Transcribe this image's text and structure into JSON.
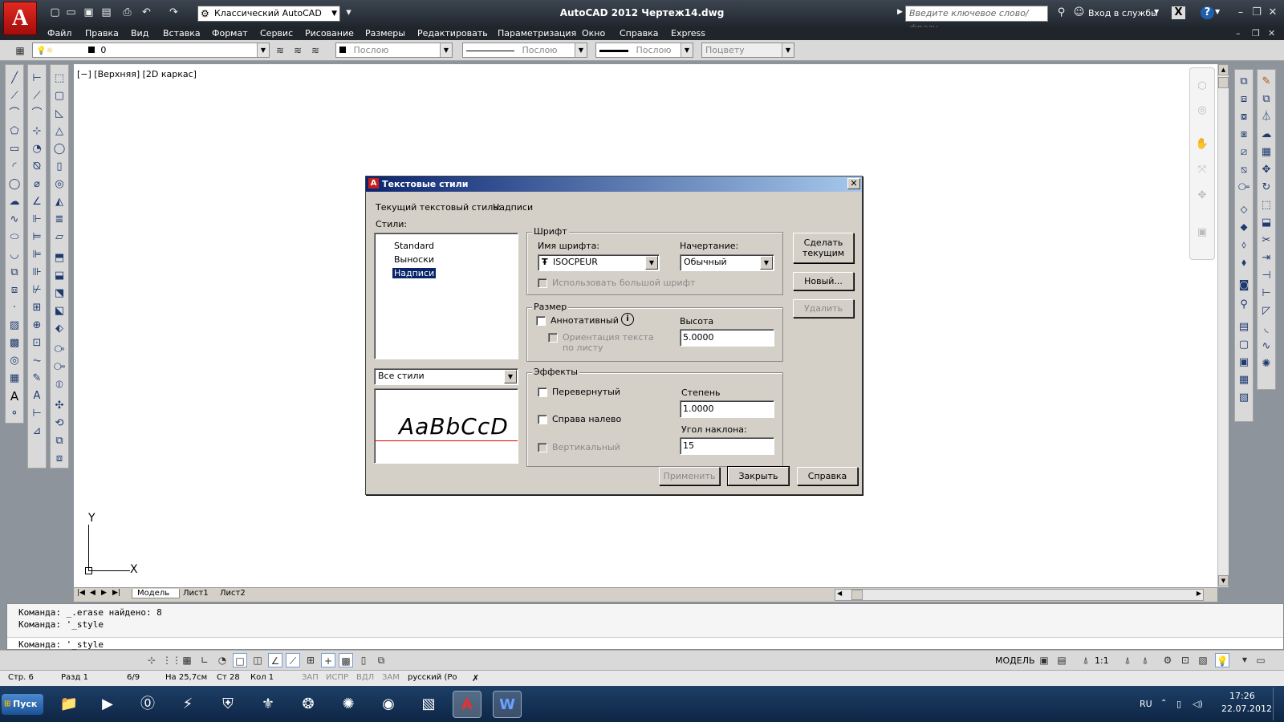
{
  "app": {
    "logo": "A",
    "title": "AutoCAD 2012    Чертеж14.dwg",
    "workspace": "Классический AutoCAD",
    "search_placeholder": "Введите ключевое слово/фразу",
    "signin": "Вход в службы",
    "help": "?"
  },
  "menu": [
    "Файл",
    "Правка",
    "Вид",
    "Вставка",
    "Формат",
    "Сервис",
    "Рисование",
    "Размеры",
    "Редактировать",
    "Параметризация",
    "Окно",
    "Справка",
    "Express"
  ],
  "layers": {
    "layer": "0",
    "color": "Послою",
    "linetype": "Послою",
    "lineweight": "Послою",
    "plotstyle": "Поцвету"
  },
  "viewport": {
    "label": "[−] [Верхняя] [2D каркас]",
    "ucs_y": "Y",
    "ucs_x": "X"
  },
  "dialog": {
    "title": "Текстовые стили",
    "current_style_label": "Текущий текстовый стиль:",
    "current_style_value": "Надписи",
    "styles_label": "Стили:",
    "styles": [
      "Standard",
      "Выноски",
      "Надписи"
    ],
    "filter": "Все стили",
    "preview": "AaBbCcD",
    "font_group": "Шрифт",
    "font_name_label": "Имя шрифта:",
    "font_name": "ISOCPEUR",
    "font_style_label": "Начертание:",
    "font_style": "Обычный",
    "bigfont": "Использовать большой шрифт",
    "size_group": "Размер",
    "annotative": "Аннотативный",
    "orient_1": "Ориентация текста",
    "orient_2": "по листу",
    "height_label": "Высота",
    "height": "5.0000",
    "effects_group": "Эффекты",
    "upside_down": "Перевернутый",
    "backwards": "Справа налево",
    "vertical": "Вертикальный",
    "width_label": "Степень растяжения:",
    "width": "1.0000",
    "oblique_label": "Угол наклона:",
    "oblique": "15",
    "btn_set_current": [
      "Сделать",
      "текущим"
    ],
    "btn_new": "Новый...",
    "btn_delete": "Удалить",
    "btn_apply": "Применить",
    "btn_close": "Закрыть",
    "btn_help": "Справка"
  },
  "tabs": [
    "Модель",
    "Лист1",
    "Лист2"
  ],
  "command": [
    "Команда:  _.erase найдено: 8",
    "Команда:  '_style",
    "Команда:  '_style"
  ],
  "status": {
    "model": "МОДЕЛЬ",
    "scale": "1:1"
  },
  "status2": {
    "page": "Стр. 6",
    "section": "Разд 1",
    "pages": "6/9",
    "at": "На 25,7см",
    "line": "Ст 28",
    "col": "Кол 1",
    "rec": "ЗАП",
    "trk": "ИСПР",
    "ext": "ВДЛ",
    "ovr": "ЗАМ",
    "lang": "русский (Ро"
  },
  "taskbar": {
    "start": "Пуск",
    "lang": "RU",
    "time": "17:26",
    "date": "22.07.2012"
  },
  "colors": {
    "accent": "#0a246a",
    "titlebar": "#20262d",
    "dialog": "#d4d0c8"
  }
}
